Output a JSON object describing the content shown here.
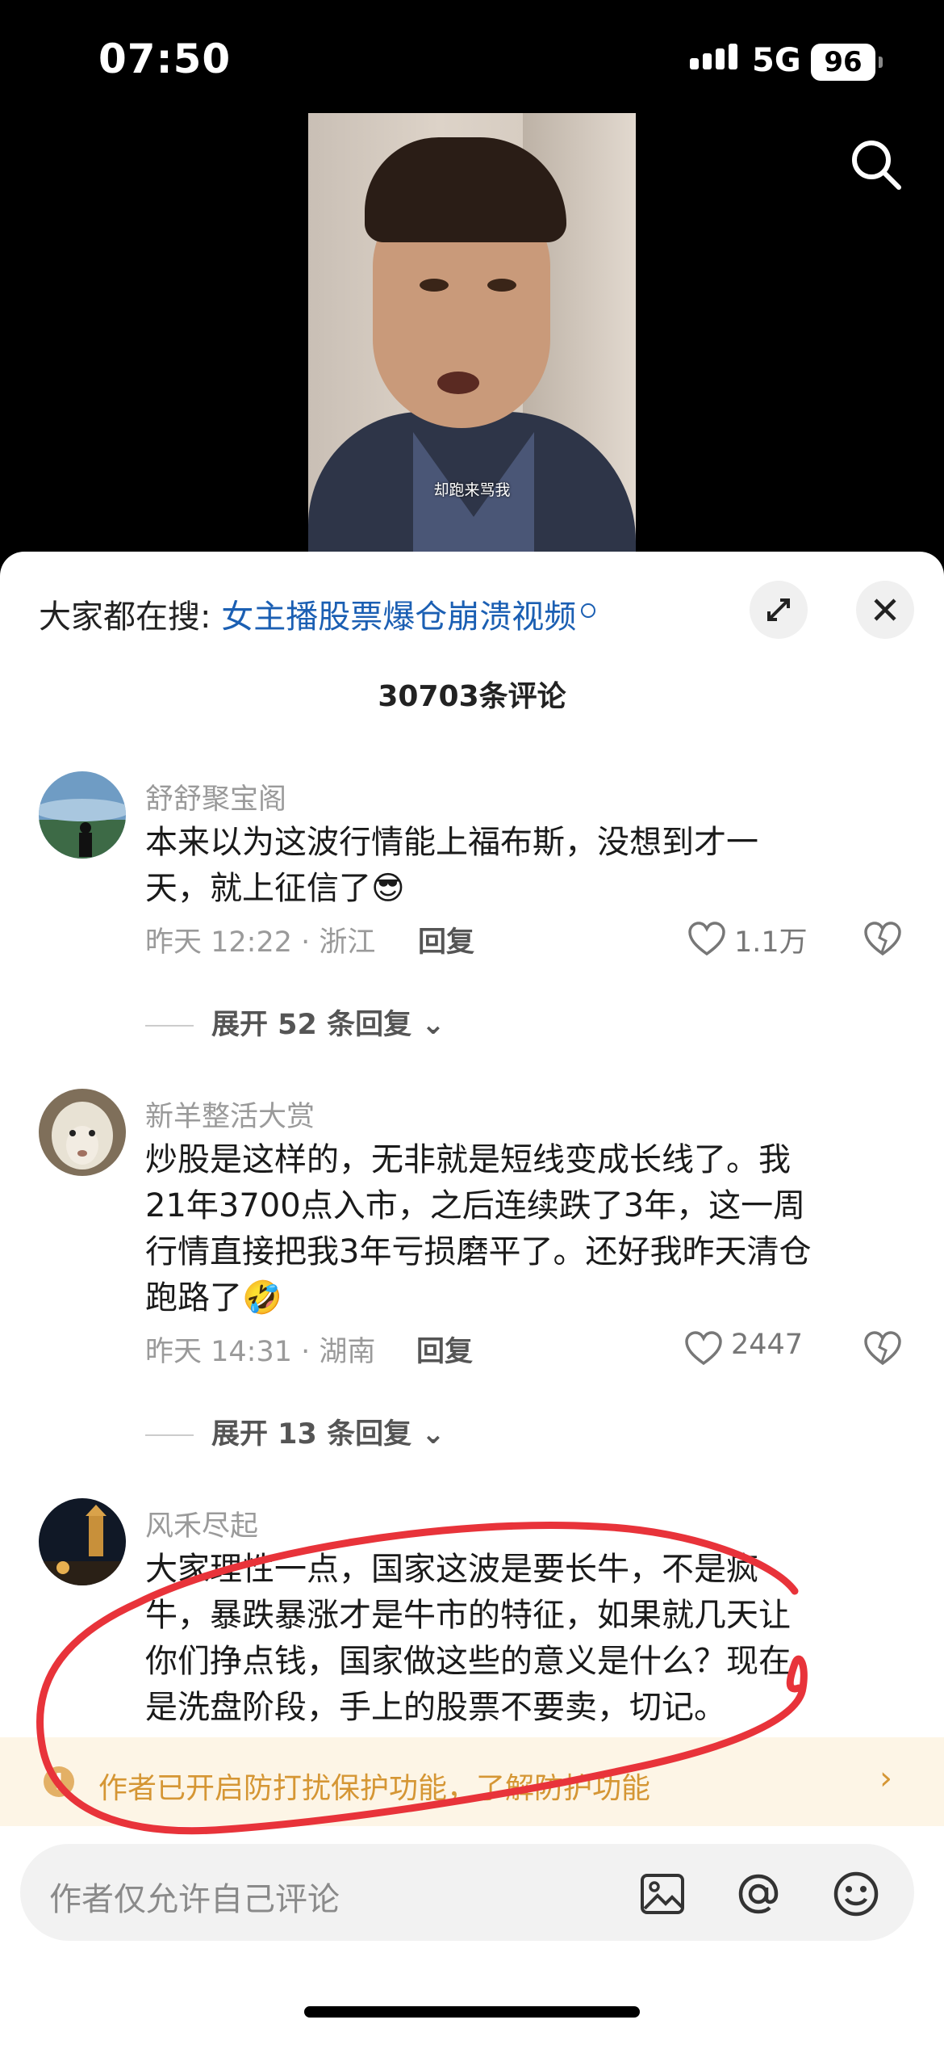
{
  "status_bar": {
    "time": "07:50",
    "network": "5G",
    "battery": "96"
  },
  "video": {
    "subtitle": "却跑来骂我"
  },
  "sheet": {
    "hot_search_prefix": "大家都在搜:",
    "hot_search_link": "女主播股票爆仓崩溃视频",
    "comment_count": "30703条评论"
  },
  "comments": [
    {
      "username": "舒舒聚宝阁",
      "text_line1": "本来以为这波行情能上福布斯，没想到才一",
      "text_line2": "天，就上征信了",
      "emoji": "😎",
      "meta": "昨天 12:22 · 浙江",
      "reply": "回复",
      "likes": "1.1万",
      "expand": "展开 52 条回复"
    },
    {
      "username": "新羊整活大赏",
      "text_line1": "炒股是这样的，无非就是短线变成长线了。我",
      "text_line2": "21年3700点入市，之后连续跌了3年，这一周",
      "text_line3": "行情直接把我3年亏损磨平了。还好我昨天清仓",
      "text_line4": "跑路了",
      "emoji": "🤣",
      "meta": "昨天 14:31 · 湖南",
      "reply": "回复",
      "likes": "2447",
      "expand": "展开 13 条回复"
    },
    {
      "username": "风禾尽起",
      "text_line1": "大家理性一点，国家这波是要长牛，不是疯",
      "text_line2": "牛，暴跌暴涨才是牛市的特征，如果就几天让",
      "text_line3": "你们挣点钱，国家做这些的意义是什么？现在",
      "text_line4": "是洗盘阶段，手上的股票不要卖，切记。"
    }
  ],
  "notice": {
    "text": "作者已开启防打扰保护功能，了解防护功能",
    "icon": "!",
    "arrow": "›"
  },
  "input": {
    "placeholder": "作者仅允许自己评论"
  },
  "colors": {
    "link": "#1b5fb3",
    "notice_bg": "#fdf5e6",
    "notice_text": "#d59634",
    "annotation": "#e8333a"
  }
}
